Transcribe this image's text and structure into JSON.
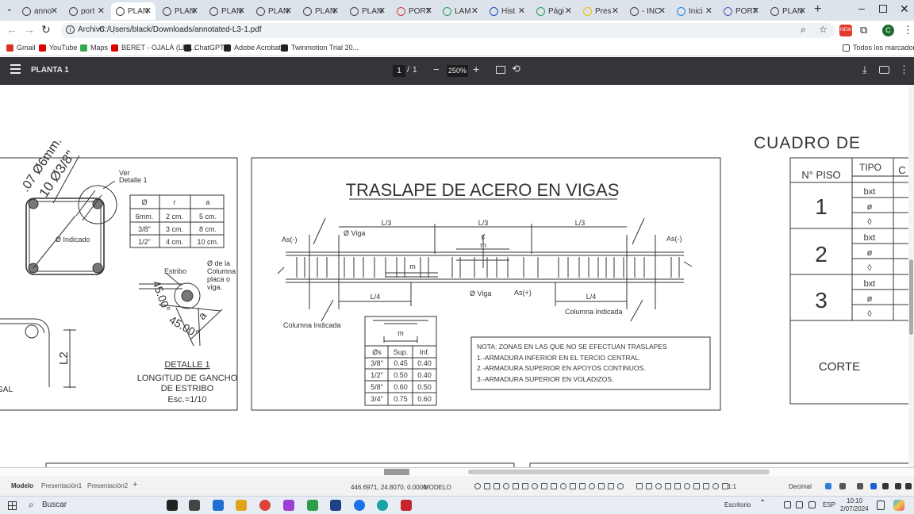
{
  "browser": {
    "tabs": [
      {
        "label": "anno",
        "favicon": "globe-icon",
        "color": "#444"
      },
      {
        "label": "port",
        "favicon": "globe-icon",
        "color": "#444"
      },
      {
        "label": "PLAN",
        "favicon": "globe-icon",
        "color": "#444",
        "active": true
      },
      {
        "label": "PLAN",
        "favicon": "globe-icon",
        "color": "#444"
      },
      {
        "label": "PLAN",
        "favicon": "globe-icon",
        "color": "#444"
      },
      {
        "label": "PLAN",
        "favicon": "globe-icon",
        "color": "#444"
      },
      {
        "label": "PLAN",
        "favicon": "globe-icon",
        "color": "#444"
      },
      {
        "label": "PLAN",
        "favicon": "globe-icon",
        "color": "#444"
      },
      {
        "label": "PORT",
        "favicon": "pinterest-icon",
        "color": "#d63c3c"
      },
      {
        "label": "LAM",
        "favicon": "drive-icon",
        "color": "#2a9d5c"
      },
      {
        "label": "Hist",
        "favicon": "bookmark-icon",
        "color": "#1b4fb8"
      },
      {
        "label": "Pági",
        "favicon": "drive-icon",
        "color": "#2a9d5c"
      },
      {
        "label": "Pres",
        "favicon": "slides-icon",
        "color": "#f2b705"
      },
      {
        "label": "- INC",
        "favicon": "globe-icon",
        "color": "#444"
      },
      {
        "label": "Inici",
        "favicon": "circle-icon",
        "color": "#1e88e5"
      },
      {
        "label": "PORT",
        "favicon": "teams-icon",
        "color": "#4b53bc"
      },
      {
        "label": "PLAN",
        "favicon": "globe-icon",
        "color": "#444"
      }
    ],
    "new_tab": "+",
    "address": {
      "site_label": "Archivo",
      "url": "C:/Users/black/Downloads/annotated-L3-1.pdf"
    },
    "bookmarks": [
      {
        "label": "Gmail",
        "color": "#d93025"
      },
      {
        "label": "YouTube",
        "color": "#e00000"
      },
      {
        "label": "Maps",
        "color": "#34a853"
      },
      {
        "label": "BERET - OJALÁ (LET...",
        "color": "#e00000"
      },
      {
        "label": "ChatGPT",
        "color": "#222"
      },
      {
        "label": "Adobe Acrobat",
        "color": "#222"
      },
      {
        "label": "Twinmotion Trial 20...",
        "color": "#222"
      }
    ],
    "all_bookmarks": "Todos los marcadores",
    "profile_initial": "C",
    "ext_badge": "NEW"
  },
  "pdf_viewer": {
    "title": "PLANTA 1",
    "page_current": "1",
    "page_sep": "/",
    "page_total": "1",
    "zoom": "250%"
  },
  "drawing": {
    "detail1": {
      "labels": [
        "Ver",
        "Detalle 1"
      ],
      "dim_text": ".07 Ø6mm.",
      "dim_text2": "10 Ø3/8\"",
      "indicado": "Ø Indicado",
      "table_headers": [
        "Ø",
        "r",
        "a"
      ],
      "table_rows": [
        [
          "6mm.",
          "2 cm.",
          "5 cm."
        ],
        [
          "3/8\"",
          "3 cm.",
          "8 cm."
        ],
        [
          "1/2\"",
          "4 cm.",
          "10 cm."
        ]
      ],
      "estribo": "Estribo",
      "columna_note": [
        "Ø de la",
        "Columna",
        "placa o",
        "viga."
      ],
      "angle1": "45.00°",
      "angle2": "45.00°",
      "a_label": "a",
      "title": "DETALLE 1",
      "subtitle1": "LONGITUD DE GANCHO",
      "subtitle2": "DE ESTRIBO",
      "scale": "Esc.=1/10",
      "l2": "L2",
      "gal": "GAL"
    },
    "traslape": {
      "title": "TRASLAPE DE ACERO EN VIGAS",
      "l3": [
        "L/3",
        "L/3",
        "L/3"
      ],
      "l4": [
        "L/4",
        "L/4"
      ],
      "as_minus": "As(-)",
      "as_minus_r": "As(-)",
      "as_plus": "As(+)",
      "viga_top": "Ø Viga",
      "viga_bottom": "Ø Viga",
      "cl": "ȼ",
      "m_top": "m",
      "m_mid": "m",
      "columna_left": "Columna Indicada",
      "columna_right": "Columna Indicada",
      "table_m": "m",
      "table_headers": [
        "Øs",
        "Sup.",
        "Inf."
      ],
      "table_rows": [
        [
          "3/8\"",
          "0.45",
          "0.40"
        ],
        [
          "1/2\"",
          "0.50",
          "0.40"
        ],
        [
          "5/8\"",
          "0.60",
          "0.50"
        ],
        [
          "3/4\"",
          "0.75",
          "0.60"
        ]
      ],
      "notes": [
        "NOTA: ZONAS EN LAS QUE NO SE EFECTUAN TRASLAPES",
        "1.-ARMADURA INFERIOR EN EL TERCIO CENTRAL.",
        "2.-ARMADURA SUPERIOR EN APOYOS CONTINUOS.",
        "3.-ARMADURA SUPERIOR EN VOLADIZOS."
      ]
    },
    "cuadro": {
      "title": "CUADRO    DE",
      "col_piso": "N° PISO",
      "col_tipo": "TIPO",
      "col_c": "C",
      "pisos": [
        "1",
        "2",
        "3"
      ],
      "sub_rows": [
        "bxt",
        "ø",
        "◊"
      ],
      "corte": "CORTE"
    }
  },
  "cad": {
    "tabs": [
      "Modelo",
      "Presentación1",
      "Presentación2"
    ],
    "add_tab": "+",
    "coords": "446.6971, 24.8070, 0.0000",
    "mode": "MODELO",
    "scale": "1:1",
    "units": "Decimal"
  },
  "taskbar": {
    "search": "Buscar",
    "desktop": "Escritorio",
    "lang": "ESP",
    "time": "10:10",
    "date": "2/07/2024"
  }
}
